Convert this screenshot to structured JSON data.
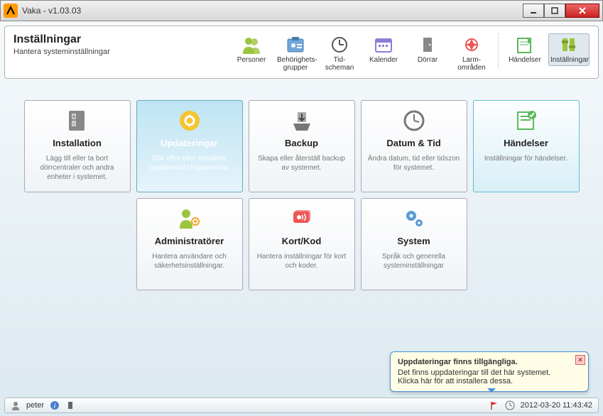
{
  "window": {
    "title": "Vaka - v1.03.03"
  },
  "header": {
    "title": "Inställningar",
    "subtitle": "Hantera systeminställningar"
  },
  "nav": [
    {
      "label": "Personer",
      "icon": "personer",
      "active": false
    },
    {
      "label": "Behörighets-grupper",
      "icon": "behor",
      "active": false
    },
    {
      "label": "Tid-scheman",
      "icon": "tid",
      "active": false
    },
    {
      "label": "Kalender",
      "icon": "kalender",
      "active": false
    },
    {
      "label": "Dörrar",
      "icon": "dorrar",
      "active": false
    },
    {
      "label": "Larm-områden",
      "icon": "larm",
      "active": false
    },
    {
      "label": "Händelser",
      "icon": "handelser",
      "active": false,
      "sep_before": true
    },
    {
      "label": "Inställningar",
      "icon": "installningar",
      "active": true
    }
  ],
  "tiles": {
    "row1": [
      {
        "title": "Installation",
        "desc": "Lägg till eller ta bort dörrcentraler och andra enheter i systemet.",
        "style": "normal"
      },
      {
        "title": "Updateringar",
        "desc": "Sök efter eller installera uppdaterad programvara.",
        "style": "highlight"
      },
      {
        "title": "Backup",
        "desc": "Skapa eller återställ backup av systemet.",
        "style": "normal"
      },
      {
        "title": "Datum & Tid",
        "desc": "Ändra datum, tid eller tidszon för systemet.",
        "style": "normal"
      },
      {
        "title": "Händelser",
        "desc": "Inställningar för händelser.",
        "style": "secondary"
      }
    ],
    "row2": [
      {
        "title": "Administratörer",
        "desc": "Hantera användare och säkerhetsinställningar.",
        "style": "normal"
      },
      {
        "title": "Kort/Kod",
        "desc": "Hantera inställningar för kort och koder.",
        "style": "normal"
      },
      {
        "title": "System",
        "desc": "Språk och generella systeminställningar",
        "style": "normal"
      }
    ]
  },
  "balloon": {
    "title": "Uppdateringar finns tillgängliga.",
    "line1": "Det finns uppdateringar till det här systemet.",
    "line2": "Klicka här för att installera dessa."
  },
  "status": {
    "user": "peter",
    "datetime": "2012-03-20 11:43:42"
  },
  "colors": {
    "orange": "#f5a623",
    "green": "#9bc53d",
    "blue": "#4a90d9",
    "red": "#e55",
    "gray": "#888"
  }
}
